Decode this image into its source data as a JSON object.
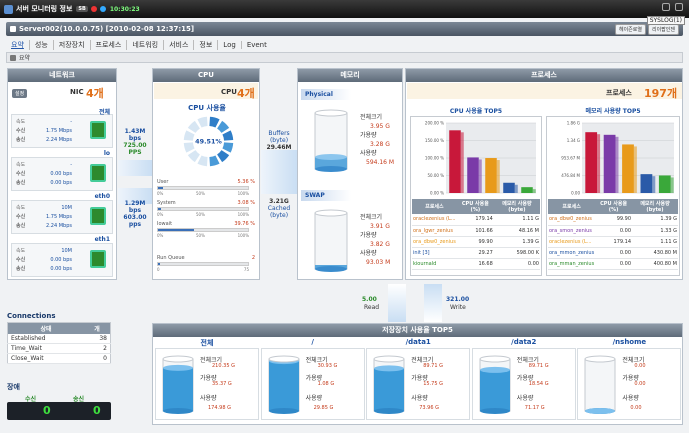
{
  "window": {
    "title": "서버 모니터링 정보",
    "badge": "SB",
    "time": "10:30:23"
  },
  "server": {
    "name": "Server002(10.0.0.75) [2010-02-08 12:37:15]",
    "btn1": "헤이즌로열",
    "btn2": "리이팝인젠",
    "syslog": "SYSLOG(1)"
  },
  "menu": [
    {
      "label": "요약"
    },
    {
      "label": "성능"
    },
    {
      "label": "저장장치"
    },
    {
      "label": "프로세스"
    },
    {
      "label": "네트워킹"
    },
    {
      "label": "서비스"
    },
    {
      "label": "정보"
    },
    {
      "label": "Log"
    },
    {
      "label": "Event"
    }
  ],
  "summary": "요약",
  "network": {
    "header": "네트워크",
    "btn": "설정",
    "nic_label": "NIC",
    "nic_count": "4개",
    "nics": [
      {
        "name": "전체",
        "speed_lbl": "속도",
        "speed": "-",
        "recv_lbl": "수신",
        "recv": "1.75 Mbps",
        "send_lbl": "송신",
        "send": "2.24 Mbps"
      },
      {
        "name": "lo",
        "speed_lbl": "속도",
        "speed": "-",
        "recv_lbl": "수신",
        "recv": "0.00 bps",
        "send_lbl": "송신",
        "send": "0.00 bps"
      },
      {
        "name": "eth0",
        "speed_lbl": "속도",
        "speed": "10M",
        "recv_lbl": "수신",
        "recv": "1.75 Mbps",
        "send_lbl": "송신",
        "send": "2.24 Mbps"
      },
      {
        "name": "eth1",
        "speed_lbl": "속도",
        "speed": "10M",
        "recv_lbl": "수신",
        "recv": "0.00 bps",
        "send_lbl": "송신",
        "send": "0.00 bps"
      }
    ],
    "flow_in": "1.43M",
    "flow_in_u": "bps",
    "flow_in2": "725.00",
    "flow_in2_u": "PPS",
    "flow_out": "1.29M",
    "flow_out_u": "bps",
    "flow_out2": "603.00",
    "flow_out2_u": "pps"
  },
  "connections": {
    "header": "Connections",
    "col1": "상태",
    "col2": "개",
    "rows": [
      {
        "state": "Established",
        "count": "38"
      },
      {
        "state": "Time_Wait",
        "count": "2"
      },
      {
        "state": "Close_Wait",
        "count": "0"
      }
    ]
  },
  "errors": {
    "header": "장애",
    "recv_lbl": "수신",
    "send_lbl": "송신",
    "recv": "0",
    "send": "0"
  },
  "cpu": {
    "header": "CPU",
    "label": "CPU",
    "count": "4개",
    "usage_title": "CPU 사용율",
    "usage": "49.51%",
    "usage_value": 49.51,
    "bars": [
      {
        "label": "User",
        "value": "5.36 %",
        "pct": 5.36
      },
      {
        "label": "System",
        "value": "3.08 %",
        "pct": 3.08
      },
      {
        "label": "Iowait",
        "value": "39.76 %",
        "pct": 39.76
      }
    ],
    "ticks": [
      "0%",
      "50%",
      "100%"
    ],
    "runq_label": "Run Queue",
    "runq_value": "2",
    "runq": 2,
    "runq_ticks": [
      "0",
      "75"
    ]
  },
  "flow_mid": {
    "buffers_lbl": "Buffers",
    "buffers_unit": "(byte)",
    "buffers": "29.46M",
    "cached_val": "3.21G",
    "cached_lbl": "Cached",
    "cached_unit": "(byte)"
  },
  "memory": {
    "header": "메모리",
    "physical": {
      "label": "Physical",
      "total_lbl": "전체크기",
      "total": "3.95 G",
      "avail_lbl": "가용량",
      "avail": "3.28 G",
      "used_lbl": "사용량",
      "used": "594.16 M"
    },
    "swap": {
      "label": "SWAP",
      "total_lbl": "전체크기",
      "total": "3.91 G",
      "avail_lbl": "가용량",
      "avail": "3.82 G",
      "used_lbl": "사용량",
      "used": "93.03 M"
    }
  },
  "process": {
    "header": "프로세스",
    "label": "프로세스",
    "count": "197개",
    "cpu_top_title": "CPU 사용율 TOP5",
    "mem_top_title": "메모리 사용량 TOP5",
    "cpu_cols": [
      "프로세스",
      "CPU 사용율(%)",
      "메모리 사용량(byte)"
    ],
    "cpu_rows": [
      {
        "name": "oraclezenius (L...",
        "cpu": "179.14",
        "mem": "1.11 G"
      },
      {
        "name": "ora_lgwr_zenius",
        "cpu": "101.66",
        "mem": "48.16 M"
      },
      {
        "name": "ora_dbw0_zenius",
        "cpu": "99.90",
        "mem": "1.39 G"
      },
      {
        "name": "init [3]",
        "cpu": "29.27",
        "mem": "598.00 K"
      },
      {
        "name": "kiournald",
        "cpu": "16.68",
        "mem": "0.00"
      }
    ],
    "mem_cols": [
      "프로세스",
      "CPU 사용율(%)",
      "메모리 사용량(byte)"
    ],
    "mem_rows": [
      {
        "name": "ora_dbw0_zenius",
        "cpu": "99.90",
        "mem": "1.39 G"
      },
      {
        "name": "ora_smon_zenius",
        "cpu": "0.00",
        "mem": "1.33 G"
      },
      {
        "name": "oraclezenius (L...",
        "cpu": "179.14",
        "mem": "1.11 G"
      },
      {
        "name": "ora_mmon_zenius",
        "cpu": "0.00",
        "mem": "430.80 M"
      },
      {
        "name": "ora_mman_zenius",
        "cpu": "0.00",
        "mem": "400.80 M"
      }
    ]
  },
  "chart_data": [
    {
      "type": "bar",
      "categories": [
        "oraclezenius (L...",
        "ora_lgwr_zenius",
        "ora_dbw0_zenius",
        "init [3]",
        "kiournald"
      ],
      "values": [
        179.14,
        101.66,
        99.9,
        29.27,
        16.68
      ],
      "ylim": [
        0,
        200
      ],
      "yticks": [
        "0.00 %",
        "50.00 %",
        "100.00 %",
        "150.00 %",
        "200.00 %"
      ],
      "colors": [
        "#c8183a",
        "#7a3aa8",
        "#e89a1a",
        "#2a5aa8",
        "#3aa83a"
      ]
    },
    {
      "type": "bar",
      "categories": [
        "ora_dbw0_zenius",
        "ora_smon_zenius",
        "oraclezenius (L...",
        "ora_mmon_zenius",
        "ora_mman_zenius"
      ],
      "values": [
        1.39,
        1.33,
        1.11,
        0.4308,
        0.4008
      ],
      "ylim": [
        0,
        1.6
      ],
      "yticks": [
        "0.00",
        "476.84 M",
        "953.67 M",
        "1.34 G",
        "1.86 G"
      ],
      "colors": [
        "#c8183a",
        "#7a3aa8",
        "#e89a1a",
        "#2a5aa8",
        "#3aa83a"
      ]
    }
  ],
  "io": {
    "read": "5.00",
    "read_lbl": "Read",
    "write": "321.00",
    "write_lbl": "Write"
  },
  "storage": {
    "header": "저장장치 사용율 TOP5",
    "items": [
      {
        "name": "전체",
        "total_lbl": "전체크기",
        "total": "210.35 G",
        "avail_lbl": "가용량",
        "avail": "35.37 G",
        "used_lbl": "사용량",
        "used": "174.98 G",
        "fill": 0.83
      },
      {
        "name": "/",
        "total_lbl": "전체크기",
        "total": "30.93 G",
        "avail_lbl": "가용량",
        "avail": "1.08 G",
        "used_lbl": "사용량",
        "used": "29.85 G",
        "fill": 0.96
      },
      {
        "name": "/data1",
        "total_lbl": "전체크기",
        "total": "89.71 G",
        "avail_lbl": "가용량",
        "avail": "15.75 G",
        "used_lbl": "사용량",
        "used": "73.96 G",
        "fill": 0.82
      },
      {
        "name": "/data2",
        "total_lbl": "전체크기",
        "total": "89.71 G",
        "avail_lbl": "가용량",
        "avail": "18.54 G",
        "used_lbl": "사용량",
        "used": "71.17 G",
        "fill": 0.79
      },
      {
        "name": "/nshome",
        "total_lbl": "전체크기",
        "total": "0.00",
        "avail_lbl": "가용량",
        "avail": "0.00",
        "used_lbl": "사용량",
        "used": "0.00",
        "fill": 0.0
      }
    ]
  }
}
